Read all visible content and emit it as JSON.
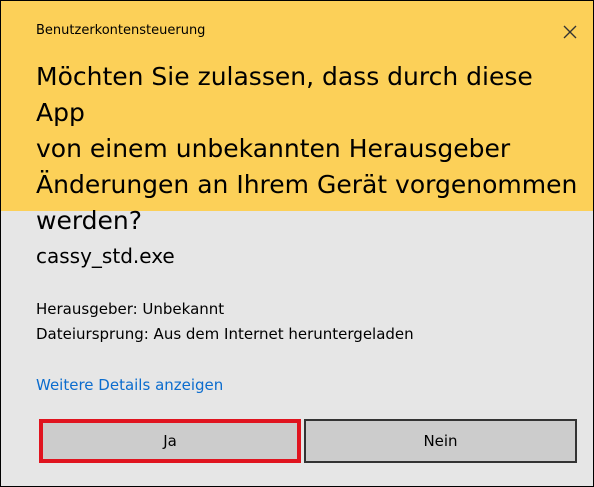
{
  "dialog": {
    "window_title": "Benutzerkontensteuerung",
    "close_icon": "close-icon",
    "question": "Möchten Sie zulassen, dass durch diese App\nvon einem unbekannten Herausgeber\nÄnderungen an Ihrem Gerät vorgenommen\nwerden?",
    "app_name": "cassy_std.exe",
    "publisher": "Herausgeber: Unbekannt",
    "origin": "Dateiursprung: Aus dem Internet heruntergeladen",
    "details_link": "Weitere Details anzeigen",
    "yes_label": "Ja",
    "no_label": "Nein"
  },
  "colors": {
    "header_background": "#fcd058",
    "body_background": "#e6e6e6",
    "link": "#0b6cce",
    "highlight_border": "#e0141f"
  }
}
